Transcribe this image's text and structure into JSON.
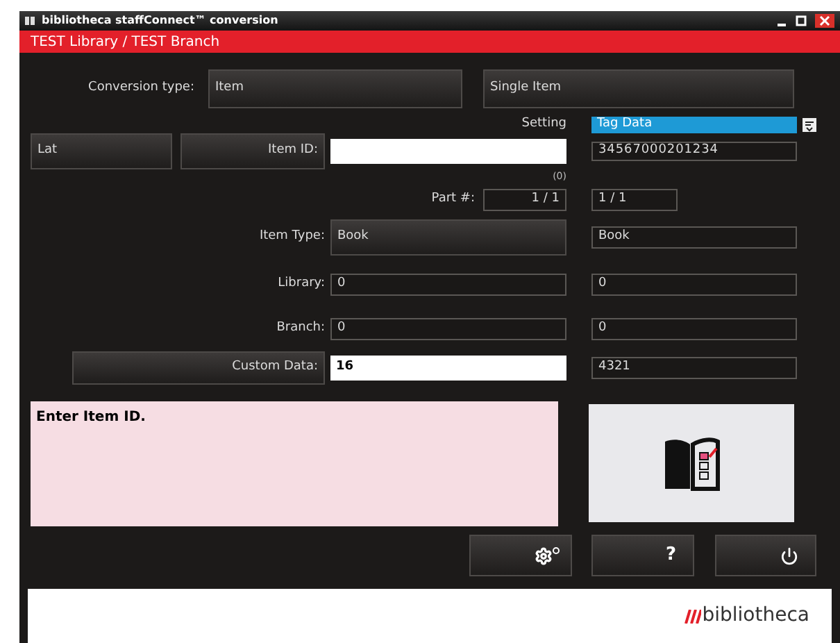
{
  "window": {
    "title": "bibliotheca staffConnect™ conversion"
  },
  "header": {
    "location": "TEST Library / TEST Branch"
  },
  "conversion_type": {
    "label": "Conversion type:",
    "value": "Item",
    "mode": "Single Item"
  },
  "setting": {
    "label": "Setting",
    "tag_data": {
      "label": "Tag Data",
      "selected": true
    },
    "tag_value": "34567000201234"
  },
  "lat_button": "Lat",
  "item_id": {
    "label": "Item ID:",
    "counter": "(0)"
  },
  "part": {
    "label": "Part #:",
    "value": "1 / 1",
    "tag_value": "1 / 1"
  },
  "fields": [
    {
      "kind": "select",
      "label": "Item Type:",
      "value": "Book",
      "tag_value": "Book"
    },
    {
      "kind": "text",
      "label": "Library:",
      "value": "0",
      "tag_value": "0"
    },
    {
      "kind": "text",
      "label": "Branch:",
      "value": "0",
      "tag_value": "0"
    },
    {
      "kind": "button",
      "label": "Custom Data:",
      "value": "16",
      "tag_value": "4321"
    }
  ],
  "message": "Enter Item ID.",
  "help_button": "?",
  "footer": {
    "logo": "bibliotheca"
  }
}
